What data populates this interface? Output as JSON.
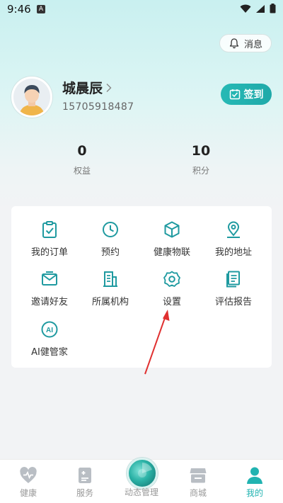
{
  "status_bar": {
    "time": "9:46",
    "notif_letter": "A"
  },
  "header": {
    "message_label": "消息"
  },
  "profile": {
    "name": "城晨辰",
    "phone": "15705918487",
    "signin_label": "签到"
  },
  "stats": [
    {
      "value": "0",
      "label": "权益"
    },
    {
      "value": "10",
      "label": "积分"
    }
  ],
  "menu": {
    "items": [
      {
        "label": "我的订单",
        "icon": "clipboard-check-icon"
      },
      {
        "label": "预约",
        "icon": "clock-icon"
      },
      {
        "label": "健康物联",
        "icon": "cube-icon"
      },
      {
        "label": "我的地址",
        "icon": "location-pin-icon"
      },
      {
        "label": "邀请好友",
        "icon": "envelope-icon"
      },
      {
        "label": "所属机构",
        "icon": "building-icon"
      },
      {
        "label": "设置",
        "icon": "gear-icon"
      },
      {
        "label": "评估报告",
        "icon": "report-icon"
      },
      {
        "label": "AI健管家",
        "icon": "ai-icon"
      }
    ]
  },
  "nav": {
    "items": [
      {
        "label": "健康",
        "icon": "heart-icon"
      },
      {
        "label": "服务",
        "icon": "service-icon"
      },
      {
        "label": "动态管理",
        "icon": "dynamic-icon"
      },
      {
        "label": "商城",
        "icon": "store-icon"
      },
      {
        "label": "我的",
        "icon": "person-icon"
      }
    ],
    "active_index": 4
  },
  "colors": {
    "accent": "#21b3b1",
    "icon": "#1f9aa0",
    "annotation": "#e03030"
  }
}
